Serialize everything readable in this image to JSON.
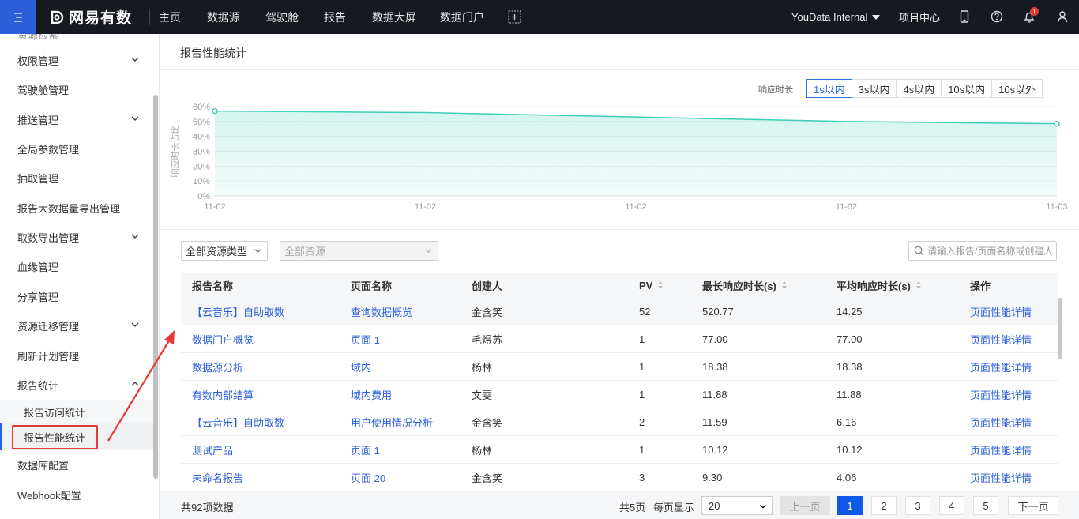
{
  "app": {
    "brand": "网易有数",
    "accent": "#2b5fd9"
  },
  "topnav": {
    "items": [
      "主页",
      "数据源",
      "驾驶舱",
      "报告",
      "数据大屏",
      "数据门户"
    ],
    "org": "YouData Internal",
    "project_center": "项目中心",
    "notification_count": "1"
  },
  "sidebar": {
    "partial_top": "资源检索",
    "items": [
      {
        "label": "权限管理",
        "expandable": true
      },
      {
        "label": "驾驶舱管理"
      },
      {
        "label": "推送管理",
        "expandable": true
      },
      {
        "label": "全局参数管理"
      },
      {
        "label": "抽取管理"
      },
      {
        "label": "报告大数据量导出管理"
      },
      {
        "label": "取数导出管理",
        "expandable": true
      },
      {
        "label": "血缘管理"
      },
      {
        "label": "分享管理"
      },
      {
        "label": "资源迁移管理",
        "expandable": true
      },
      {
        "label": "刷新计划管理"
      },
      {
        "label": "报告统计",
        "expanded": true
      },
      {
        "label": "报告访问统计",
        "sub": true
      },
      {
        "label": "报告性能统计",
        "sub": true,
        "active": true
      },
      {
        "label": "数据库配置"
      },
      {
        "label": "Webhook配置"
      }
    ]
  },
  "page": {
    "title": "报告性能统计"
  },
  "chart_controls": {
    "label": "响应时长",
    "options": [
      "1s以内",
      "3s以内",
      "4s以内",
      "10s以内",
      "10s以外"
    ],
    "selected": "1s以内"
  },
  "chart_data": {
    "type": "area",
    "ylabel": "响应时长占比",
    "x": [
      "11-02",
      "11-02",
      "11-02",
      "11-02",
      "11-03"
    ],
    "yticks": [
      "0%",
      "10%",
      "20%",
      "30%",
      "40%",
      "50%",
      "60%"
    ],
    "ylim": [
      0,
      60
    ],
    "series": [
      {
        "values": [
          57,
          56,
          53,
          50,
          48.5
        ]
      }
    ],
    "color": "#3dcfb4",
    "grid": true
  },
  "filters": {
    "resource_type": "全部资源类型",
    "resource": "全部资源",
    "search_placeholder": "请输入报告/页面名称或创建人"
  },
  "table": {
    "headers": [
      "报告名称",
      "页面名称",
      "创建人",
      "PV",
      "最长响应时长(s)",
      "平均响应时长(s)",
      "操作"
    ],
    "rows": [
      {
        "report": "【云音乐】自助取数",
        "page": "查询数据概览",
        "creator": "金含笑",
        "pv": "52",
        "max": "520.77",
        "avg": "14.25",
        "action": "页面性能详情"
      },
      {
        "report": "数据门户概览",
        "page": "页面 1",
        "creator": "毛煜苏",
        "pv": "1",
        "max": "77.00",
        "avg": "77.00",
        "action": "页面性能详情"
      },
      {
        "report": "数据源分析",
        "page": "域内",
        "creator": "杨林",
        "pv": "1",
        "max": "18.38",
        "avg": "18.38",
        "action": "页面性能详情"
      },
      {
        "report": "有数内部结算",
        "page": "域内费用",
        "creator": "文雯",
        "pv": "1",
        "max": "11.88",
        "avg": "11.88",
        "action": "页面性能详情"
      },
      {
        "report": "【云音乐】自助取数",
        "page": "用户使用情况分析",
        "creator": "金含笑",
        "pv": "2",
        "max": "11.59",
        "avg": "6.16",
        "action": "页面性能详情"
      },
      {
        "report": "测试产品",
        "page": "页面 1",
        "creator": "杨林",
        "pv": "1",
        "max": "10.12",
        "avg": "10.12",
        "action": "页面性能详情"
      },
      {
        "report": "未命名报告",
        "page": "页面 20",
        "creator": "金含笑",
        "pv": "3",
        "max": "9.30",
        "avg": "4.06",
        "action": "页面性能详情"
      }
    ]
  },
  "footer": {
    "total": "共92项数据",
    "pages_total": "共5页",
    "per_page_label": "每页显示",
    "per_page": "20",
    "prev": "上一页",
    "pages": [
      "1",
      "2",
      "3",
      "4",
      "5"
    ],
    "current": "1",
    "next": "下一页"
  }
}
